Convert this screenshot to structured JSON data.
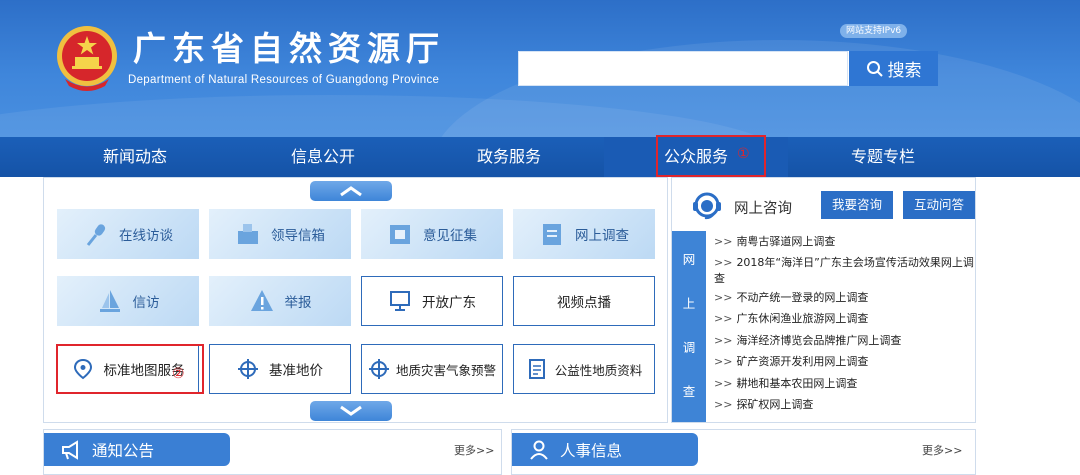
{
  "header": {
    "title": "广东省自然资源厅",
    "subtitle": "Department of Natural Resources of Guangdong Province",
    "ipv6_badge": "网站支持IPv6",
    "search": {
      "placeholder": "",
      "button_label": "搜索"
    }
  },
  "nav": {
    "items": [
      "新闻动态",
      "信息公开",
      "政务服务",
      "公众服务",
      "专题专栏"
    ],
    "active": "公众服务",
    "annotation_1": "①"
  },
  "services": {
    "tiles": [
      {
        "label": "在线访谈",
        "icon": "microphone-icon",
        "style": "blue"
      },
      {
        "label": "领导信箱",
        "icon": "mailbox-icon",
        "style": "blue"
      },
      {
        "label": "意见征集",
        "icon": "inbox-icon",
        "style": "blue"
      },
      {
        "label": "网上调查",
        "icon": "survey-icon",
        "style": "blue"
      },
      {
        "label": "信访",
        "icon": "sail-icon",
        "style": "blue"
      },
      {
        "label": "举报",
        "icon": "warning-icon",
        "style": "blue"
      },
      {
        "label": "开放广东",
        "icon": "monitor-icon",
        "style": "white"
      },
      {
        "label": "视频点播",
        "icon": "",
        "style": "white"
      },
      {
        "label": "标准地图服务",
        "icon": "map-pin-icon",
        "style": "white"
      },
      {
        "label": "基准地价",
        "icon": "crosshair-icon",
        "style": "white"
      },
      {
        "label": "地质灾害气象预警",
        "icon": "crosshair-icon",
        "style": "white"
      },
      {
        "label": "公益性地质资料",
        "icon": "document-icon",
        "style": "white"
      }
    ],
    "annotation_2": "②"
  },
  "consult": {
    "title": "网上咨询",
    "btn_ask": "我要咨询",
    "btn_qa": "互动问答",
    "side_label": [
      "网",
      "上",
      "调",
      "查"
    ],
    "arrows": ">>",
    "items": [
      "南粤古驿道网上调查",
      "2018年“海洋日”广东主会场宣传活动效果网上调查",
      "不动产统一登录的网上调查",
      "广东休闲渔业旅游网上调查",
      "海洋经济博览会品牌推广网上调查",
      "矿产资源开发利用网上调查",
      "耕地和基本农田网上调查",
      "探矿权网上调查"
    ]
  },
  "notice": {
    "title": "通知公告",
    "more": "更多>>"
  },
  "hr": {
    "title": "人事信息",
    "more": "更多>>"
  },
  "colors": {
    "primary": "#2b6ec6",
    "nav_bg": "#1553a7",
    "highlight_red": "#e0252c"
  }
}
